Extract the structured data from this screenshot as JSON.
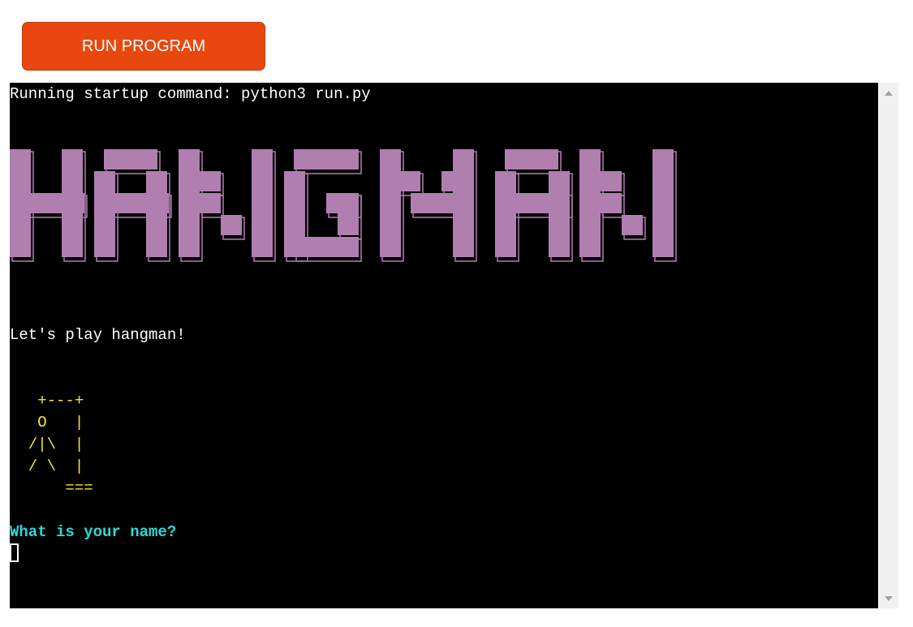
{
  "toolbar": {
    "run_label": "RUN PROGRAM",
    "run_color": "#e8480f"
  },
  "terminal": {
    "startup_line": "Running startup command: python3 run.py",
    "banner_text": "HANGMAN",
    "banner_color": "#b07fb0",
    "greeting": "Let's play hangman!",
    "gallows": [
      "   +---+",
      "   O   |",
      "  /|\\  |",
      "  / \\  |",
      "      ==="
    ],
    "prompt": "What is your name?",
    "colors": {
      "text": "#ffffff",
      "gallows": "#f5e23b",
      "prompt": "#2fd6d6",
      "background": "#000000"
    }
  },
  "scrollbar": {
    "up_icon": "triangle-up-icon",
    "down_icon": "triangle-down-icon"
  }
}
